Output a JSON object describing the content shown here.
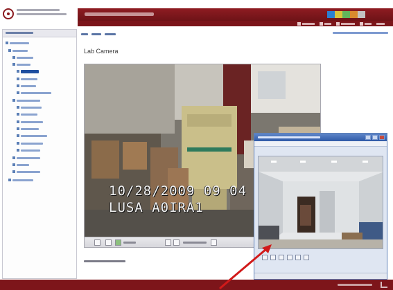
{
  "page": {
    "title": "Lab Camera"
  },
  "camera": {
    "timestamp": "10/28/2009 09 04",
    "camera_name": "LUSA A0IRA1"
  },
  "colors": {
    "brand": "#8b1a1f",
    "header_bar": "#7b151a",
    "link": "#3b5fa6",
    "annotation_arrow": "#d11a1a",
    "window_title": "#3f69b5"
  },
  "icons": {
    "logo": "circle-logo-icon",
    "popup_close": "close-icon",
    "camera_toolbar": [
      "toolbar-icon",
      "play-icon",
      "zoom-in-icon",
      "zoom-out-icon"
    ],
    "annotation": "arrow-icon"
  }
}
